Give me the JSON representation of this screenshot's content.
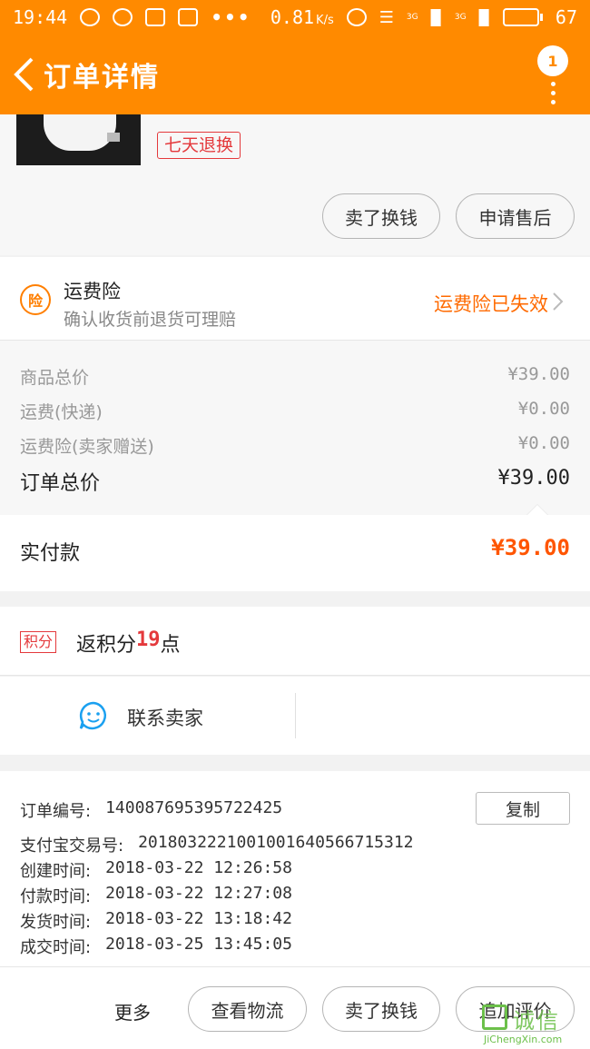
{
  "status_bar": {
    "time": "19:44",
    "speed": "0.81",
    "speed_unit": "K/s",
    "net1": "3G",
    "net2": "3G",
    "battery": "67",
    "battery_level": 0.67,
    "more_dots": "•••"
  },
  "navbar": {
    "title": "订单详情",
    "notification_count": "1"
  },
  "product": {
    "tag": "七天退换",
    "actions": [
      "卖了换钱",
      "申请售后"
    ]
  },
  "insurance": {
    "icon_text": "险",
    "title": "运费险",
    "subtitle": "确认收货前退货可理赔",
    "status": "运费险已失效"
  },
  "prices": {
    "rows": [
      {
        "label": "商品总价",
        "value": "¥39.00"
      },
      {
        "label": "运费(快递)",
        "value": "¥0.00"
      },
      {
        "label": "运费险(卖家赠送)",
        "value": "¥0.00"
      }
    ],
    "total_label": "订单总价",
    "total_value": "¥39.00",
    "paid_label": "实付款",
    "paid_value": "¥39.00"
  },
  "points": {
    "badge": "积分",
    "prefix": "返积分",
    "count": "19",
    "suffix": "点"
  },
  "contact": {
    "label": "联系卖家"
  },
  "order_info": {
    "copy_label": "复制",
    "rows": [
      {
        "label": "订单编号:",
        "value": "1400876953957224​25"
      },
      {
        "label": "支付宝交易号:",
        "value": "2018032221001001640566715312"
      },
      {
        "label": "创建时间:",
        "value": "2018-03-22 12:26:58"
      },
      {
        "label": "付款时间:",
        "value": "2018-03-22 12:27:08"
      },
      {
        "label": "发货时间:",
        "value": "2018-03-22 13:18:42"
      },
      {
        "label": "成交时间:",
        "value": "2018-03-25 13:45:05"
      }
    ]
  },
  "bottom_bar": {
    "more": "更多",
    "buttons": [
      "查看物流",
      "卖了换钱",
      "追加评价"
    ]
  },
  "watermark": {
    "text": "诚信",
    "url": "JiChengXin.com"
  },
  "colors": {
    "header": "#ff8a00",
    "accent": "#ff6a00",
    "tag_red": "#e4393c"
  }
}
